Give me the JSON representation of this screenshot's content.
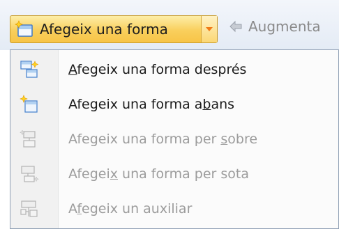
{
  "toolbar": {
    "add_shape": {
      "label": "Afegeix una forma",
      "icon": "add-shape-icon"
    },
    "promote": {
      "label": "Augmenta",
      "icon": "left-arrow-icon"
    }
  },
  "menu": {
    "items": [
      {
        "pre": "",
        "u": "A",
        "post": "fegeix una forma després",
        "enabled": true,
        "icon": "add-shape-after-icon"
      },
      {
        "pre": "Afegeix una forma a",
        "u": "b",
        "post": "ans",
        "enabled": true,
        "icon": "add-shape-before-icon"
      },
      {
        "pre": "Afegeix una forma per ",
        "u": "s",
        "post": "obre",
        "enabled": false,
        "icon": "add-shape-above-icon"
      },
      {
        "pre": "Afegei",
        "u": "x",
        "post": " una forma per sota",
        "enabled": false,
        "icon": "add-shape-below-icon"
      },
      {
        "pre": "A",
        "u": "f",
        "post": "egeix un auxiliar",
        "enabled": false,
        "icon": "add-assistant-icon"
      }
    ]
  }
}
